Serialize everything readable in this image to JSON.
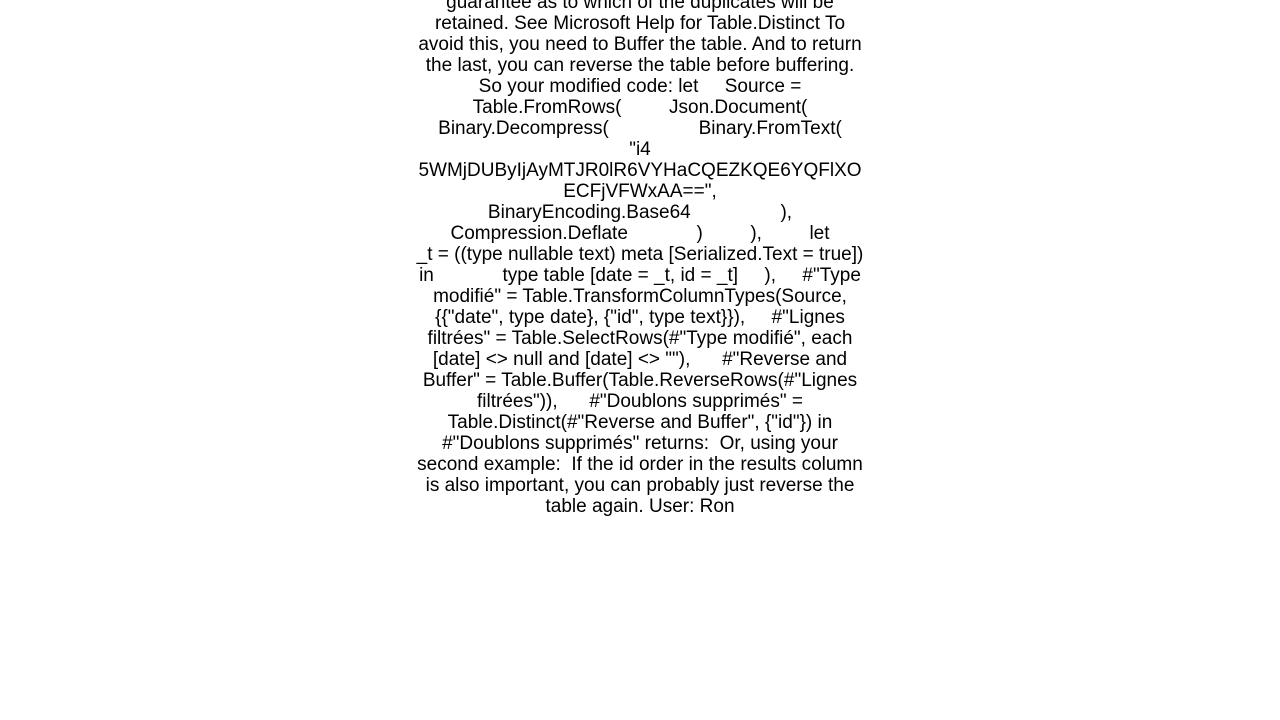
{
  "body_text": "guarantee as to which of the duplicates will be retained. See Microsoft Help for Table.Distinct To avoid this, you need to Buffer the table. And to return the last, you can reverse the table before buffering. So your modified code: let     Source = Table.FromRows(         Json.Document(             Binary.Decompress(                 Binary.FromText(                     \"i4 5WMjDUByIjAyMTJR0lR6VYHaCQEZKQE6YQFlXOECFjVFWxAA==\",                     BinaryEncoding.Base64                 ),                 Compression.Deflate             )         ),         let             _t = ((type nullable text) meta [Serialized.Text = true])         in             type table [date = _t, id = _t]     ),     #\"Type modifié\" = Table.TransformColumnTypes(Source, {{\"date\", type date}, {\"id\", type text}}),     #\"Lignes filtrées\" = Table.SelectRows(#\"Type modifié\", each [date] <> null and [date] <> \"\"),      #\"Reverse and Buffer\" = Table.Buffer(Table.ReverseRows(#\"Lignes filtrées\")),      #\"Doublons supprimés\" = Table.Distinct(#\"Reverse and Buffer\", {\"id\"}) in     #\"Doublons supprimés\" returns:  Or, using your second example:  If the id order in the results column is also important, you can probably just reverse the table again. User: Ron"
}
